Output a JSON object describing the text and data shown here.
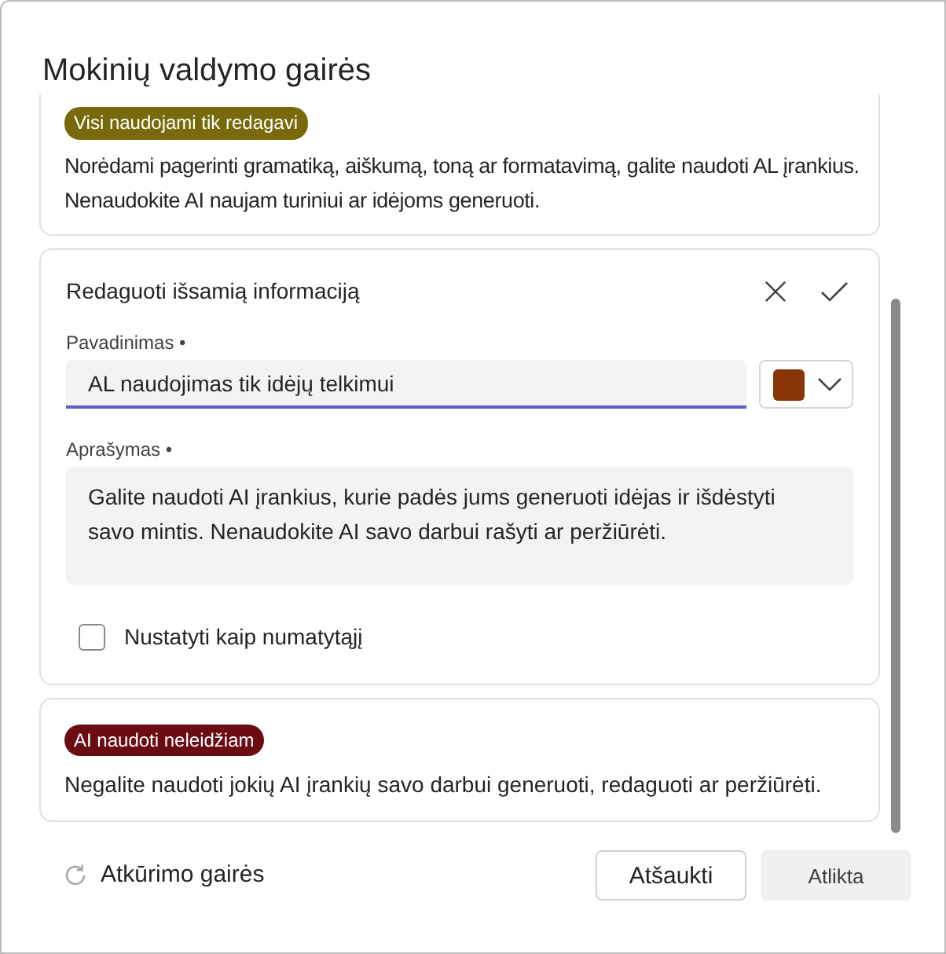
{
  "dialog": {
    "title": "Mokinių valdymo gairės"
  },
  "guidelines": [
    {
      "kind": "view",
      "badge": {
        "label": "Visi naudojami tik redagavi",
        "color": "#786a0c"
      },
      "description": "Norėdami pagerinti gramatiką, aiškumą, toną ar formatavimą, galite naudoti AL įrankius. Nenaudokite AI naujam turiniui ar idėjoms generuoti."
    },
    {
      "kind": "edit",
      "heading": "Redaguoti išsamią informaciją",
      "name_field": {
        "label": "Pavadinimas •",
        "value": "AL naudojimas tik idėjų telkimui",
        "focused": true
      },
      "color_picker": {
        "color": "#8a3508"
      },
      "description_field": {
        "label": "Aprašymas •",
        "value": "Galite naudoti AI įrankius, kurie padės jums generuoti idėjas ir išdėstyti savo mintis. Nenaudokite AI savo darbui rašyti ar peržiūrėti."
      },
      "default_checkbox": {
        "label": "Nustatyti kaip numatytąjį",
        "checked": false
      }
    },
    {
      "kind": "view",
      "badge": {
        "label": "AI naudoti neleidžiam",
        "color": "#6b0b12"
      },
      "description": "Negalite naudoti jokių AI įrankių savo darbui generuoti, redaguoti ar peržiūrėti."
    }
  ],
  "footer": {
    "reset_link": "Atkūrimo gairės",
    "buttons": [
      {
        "label": "Atšaukti",
        "kind": "secondary",
        "disabled": false
      },
      {
        "label": "Atlikta",
        "kind": "primary",
        "disabled": true
      }
    ]
  }
}
